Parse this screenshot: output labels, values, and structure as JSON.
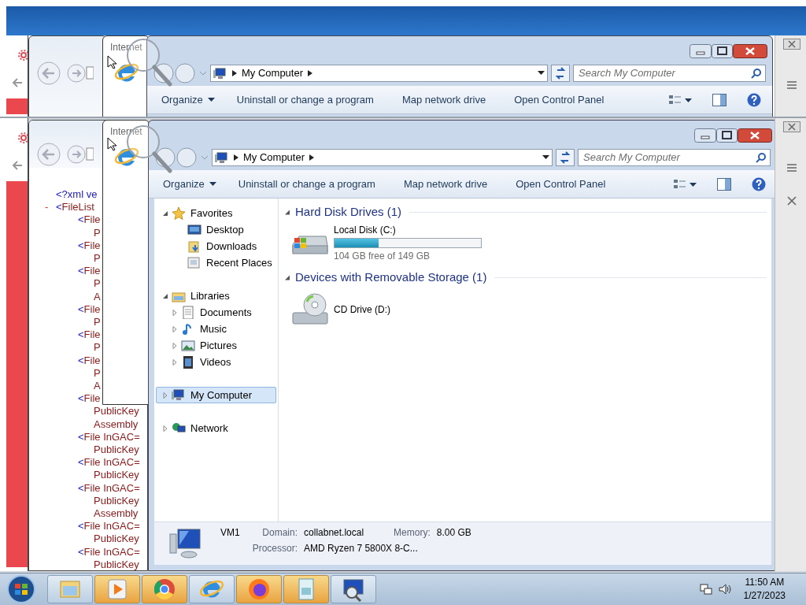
{
  "upper_copy": {
    "thumbnail_title": "Internet",
    "explorer": {
      "address": "My Computer",
      "search": {
        "placeholder": "Search My Computer"
      },
      "toolbar": [
        {
          "label": "Organize",
          "dropdown": true
        },
        {
          "label": "Uninstall or change a program",
          "dropdown": false
        },
        {
          "label": "Map network drive",
          "dropdown": false
        },
        {
          "label": "Open Control Panel",
          "dropdown": false
        }
      ]
    }
  },
  "xml_document": {
    "declaration": "<?xml ve",
    "root": {
      "toggle": "-",
      "tag": "<FileList",
      "children": [
        {
          "tag": "<File",
          "attributes": [
            "P"
          ]
        },
        {
          "tag": "<File",
          "attributes": [
            "P"
          ]
        },
        {
          "tag": "<File",
          "attributes": [
            "P",
            "A"
          ]
        },
        {
          "tag": "<File",
          "attributes": [
            "P"
          ]
        },
        {
          "tag": "<File",
          "attributes": [
            "P"
          ]
        },
        {
          "tag": "<File",
          "attributes": [
            "P",
            "A"
          ]
        },
        {
          "tag": "<File",
          "attributes": [
            "PublicKey",
            "Assembly"
          ]
        },
        {
          "tag": "<File InGAC=",
          "attributes": [
            "PublicKey"
          ]
        },
        {
          "tag": "<File InGAC=",
          "attributes": [
            "PublicKey"
          ]
        },
        {
          "tag": "<File InGAC=",
          "attributes": [
            "PublicKey",
            "Assembly"
          ]
        },
        {
          "tag": "<File InGAC=",
          "attributes": [
            "PublicKey"
          ]
        },
        {
          "tag": "<File InGAC=",
          "attributes": [
            "PublicKey"
          ]
        }
      ]
    }
  },
  "thumbnail": {
    "title": "Internet"
  },
  "explorer": {
    "address": "My Computer",
    "search": {
      "placeholder": "Search My Computer"
    },
    "toolbar": [
      {
        "label": "Organize",
        "dropdown": true
      },
      {
        "label": "Uninstall or change a program",
        "dropdown": false
      },
      {
        "label": "Map network drive",
        "dropdown": false
      },
      {
        "label": "Open Control Panel",
        "dropdown": false
      }
    ],
    "navigation": [
      {
        "label": "Favorites",
        "kind": "favorites",
        "expanded": true,
        "selected": false,
        "children": [
          {
            "label": "Desktop",
            "kind": "desktop",
            "selected": false
          },
          {
            "label": "Downloads",
            "kind": "downloads",
            "selected": false
          },
          {
            "label": "Recent Places",
            "kind": "recent",
            "selected": false
          }
        ]
      },
      {
        "label": "Libraries",
        "kind": "libraries",
        "expanded": true,
        "selected": false,
        "children": [
          {
            "label": "Documents",
            "kind": "documents",
            "expanded": false,
            "selected": false
          },
          {
            "label": "Music",
            "kind": "music",
            "expanded": false,
            "selected": false
          },
          {
            "label": "Pictures",
            "kind": "pictures",
            "expanded": false,
            "selected": false
          },
          {
            "label": "Videos",
            "kind": "videos",
            "expanded": false,
            "selected": false
          }
        ]
      },
      {
        "label": "My Computer",
        "kind": "computer",
        "expanded": false,
        "selected": true
      },
      {
        "label": "Network",
        "kind": "network",
        "expanded": false,
        "selected": false
      }
    ],
    "groups": [
      {
        "title": "Hard Disk Drives (1)",
        "expanded": true,
        "items": [
          {
            "kind": "disk",
            "name": "Local Disk (C:)",
            "level": 0.3,
            "free": "104 GB free of 149 GB"
          }
        ]
      },
      {
        "title": "Devices with Removable Storage (1)",
        "expanded": true,
        "items": [
          {
            "kind": "cd",
            "name": "CD Drive (D:)"
          }
        ]
      }
    ],
    "details": {
      "name": "VM1",
      "fields": [
        {
          "label": "Domain:",
          "value": "collabnet.local"
        },
        {
          "label": "Memory:",
          "value": "8.00 GB"
        },
        {
          "label": "Processor:",
          "value": "AMD Ryzen 7 5800X 8-C..."
        }
      ]
    }
  },
  "taskbar": {
    "items": [
      {
        "kind": "explorer",
        "highlighted": false
      },
      {
        "kind": "media",
        "highlighted": true
      },
      {
        "kind": "chrome",
        "highlighted": true
      },
      {
        "kind": "ie",
        "highlighted": false
      },
      {
        "kind": "firefox",
        "highlighted": true
      },
      {
        "kind": "notepad",
        "highlighted": true
      },
      {
        "kind": "computer",
        "highlighted": false
      }
    ],
    "clock": {
      "time": "11:50 AM",
      "date": "1/27/2023"
    }
  }
}
